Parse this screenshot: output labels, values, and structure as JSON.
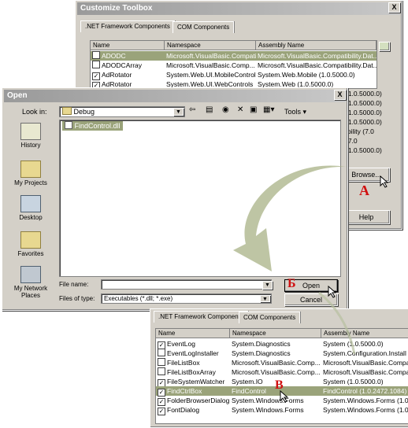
{
  "customize": {
    "title": "Customize Toolbox",
    "close": "X",
    "tabs": [
      ".NET Framework Components",
      "COM Components"
    ],
    "columns": [
      "Name",
      "Namespace",
      "Assembly Name"
    ],
    "rows": [
      {
        "checked": false,
        "name": "ADODC",
        "ns": "Microsoft.VisualBasic.Compatibility.Dat...",
        "asm": "Microsoft.VisualBasic.Compatibility.Dat..."
      },
      {
        "checked": false,
        "name": "ADODCArray",
        "ns": "Microsoft.VisualBasic.Comp...",
        "asm": "Microsoft.VisualBasic.Compatibility.Dat..."
      },
      {
        "checked": true,
        "name": "AdRotator",
        "ns": "System.Web.UI.MobileControls",
        "asm": "System.Web.Mobile (1.0.5000.0)"
      },
      {
        "checked": true,
        "name": "AdRotator",
        "ns": "System.Web.UI.WebControls",
        "asm": "System.Web (1.0.5000.0)"
      }
    ],
    "side_values": [
      "(1.0.5000.0)",
      "(1.0.5000.0)",
      "(1.0.5000.0)",
      "(1.0.5000.0)",
      "ibility (7.0",
      "(7.0",
      "(1.0.5000.0)"
    ],
    "browse": "Browse...",
    "help": "Help"
  },
  "open": {
    "title": "Open",
    "look_in_label": "Look in:",
    "look_in_value": "Debug",
    "tools": "Tools",
    "file": "FindControl.dll",
    "places": [
      "History",
      "My Projects",
      "Desktop",
      "Favorites",
      "My Network Places"
    ],
    "file_name_label": "File name:",
    "file_name_value": "",
    "files_of_type_label": "Files of type:",
    "files_of_type_value": "Executables (*.dll; *.exe)",
    "open_btn": "Open",
    "cancel_btn": "Cancel"
  },
  "bottom": {
    "tabs": [
      ".NET Framework Components",
      "COM Components"
    ],
    "columns": [
      "Name",
      "Namespace",
      "Assembly Name"
    ],
    "rows": [
      {
        "checked": true,
        "name": "EventLog",
        "ns": "System.Diagnostics",
        "asm": "System (1.0.5000.0)",
        "sel": false
      },
      {
        "checked": false,
        "name": "EventLogInstaller",
        "ns": "System.Diagnostics",
        "asm": "System.Configuration.Install (1.0",
        "sel": false
      },
      {
        "checked": false,
        "name": "FileListBox",
        "ns": "Microsoft.VisualBasic.Comp...",
        "asm": "Microsoft.VisualBasic.Compatib",
        "sel": false
      },
      {
        "checked": false,
        "name": "FileListBoxArray",
        "ns": "Microsoft.VisualBasic.Comp...",
        "asm": "Microsoft.VisualBasic.Compatib",
        "sel": false
      },
      {
        "checked": true,
        "name": "FileSystemWatcher",
        "ns": "System.IO",
        "asm": "System (1.0.5000.0)",
        "sel": false
      },
      {
        "checked": true,
        "name": "FindCtrlBox",
        "ns": "FindControl",
        "asm": "FindControl (1.0.2472.1084)",
        "sel": true
      },
      {
        "checked": true,
        "name": "FolderBrowserDialog",
        "ns": "System.Windows.Forms",
        "asm": "System.Windows.Forms (1.0.50",
        "sel": false
      },
      {
        "checked": true,
        "name": "FontDialog",
        "ns": "System.Windows.Forms",
        "asm": "System.Windows.Forms (1.0.50",
        "sel": false
      }
    ]
  },
  "marks": {
    "a": "A",
    "b": "Б",
    "c": "B"
  },
  "colors": {
    "arrow": "#a8b286",
    "mark": "#d01010",
    "selection": "#9aa37a"
  }
}
